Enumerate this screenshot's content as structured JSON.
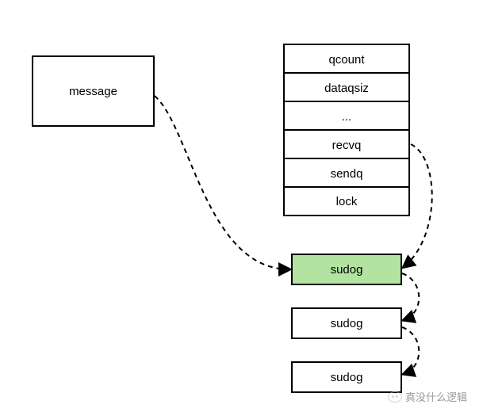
{
  "message": {
    "label": "message"
  },
  "struct": {
    "fields": [
      "qcount",
      "dataqsiz",
      "...",
      "recvq",
      "sendq",
      "lock"
    ]
  },
  "sudogs": [
    {
      "label": "sudog",
      "highlight": true
    },
    {
      "label": "sudog",
      "highlight": false
    },
    {
      "label": "sudog",
      "highlight": false
    }
  ],
  "watermark": "真没什么逻辑"
}
